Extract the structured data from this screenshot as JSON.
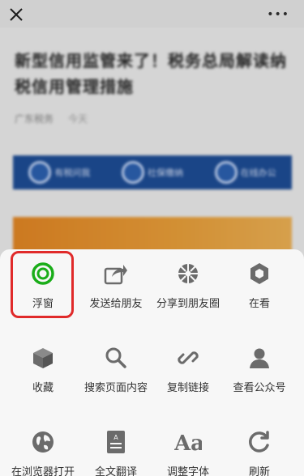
{
  "article": {
    "title": "新型信用监管来了！税务总局解读纳税信用管理措施",
    "meta_source": "广东税务",
    "meta_date": "今天",
    "banner_items": [
      "有税问我",
      "社保缴纳",
      "在线办公"
    ]
  },
  "menu": {
    "row1": [
      {
        "label": "浮窗",
        "icon": "float-window-icon"
      },
      {
        "label": "发送给朋友",
        "icon": "share-arrow-icon"
      },
      {
        "label": "分享到朋友圈",
        "icon": "moments-icon"
      },
      {
        "label": "在看",
        "icon": "wow-icon"
      }
    ],
    "row2": [
      {
        "label": "收藏",
        "icon": "favorite-cube-icon"
      },
      {
        "label": "搜索页面内容",
        "icon": "search-icon"
      },
      {
        "label": "复制链接",
        "icon": "link-icon"
      },
      {
        "label": "查看公众号",
        "icon": "person-icon"
      }
    ],
    "row3": [
      {
        "label": "在浏览器打开",
        "icon": "globe-icon"
      },
      {
        "label": "全文翻译",
        "icon": "translate-document-icon"
      },
      {
        "label": "调整字体",
        "icon": "font-size-icon"
      },
      {
        "label": "刷新",
        "icon": "refresh-icon"
      }
    ]
  },
  "colors": {
    "float_icon_green": "#1aad19",
    "highlight_red": "#e02a2a",
    "icon_gray": "#6b6b6b"
  }
}
